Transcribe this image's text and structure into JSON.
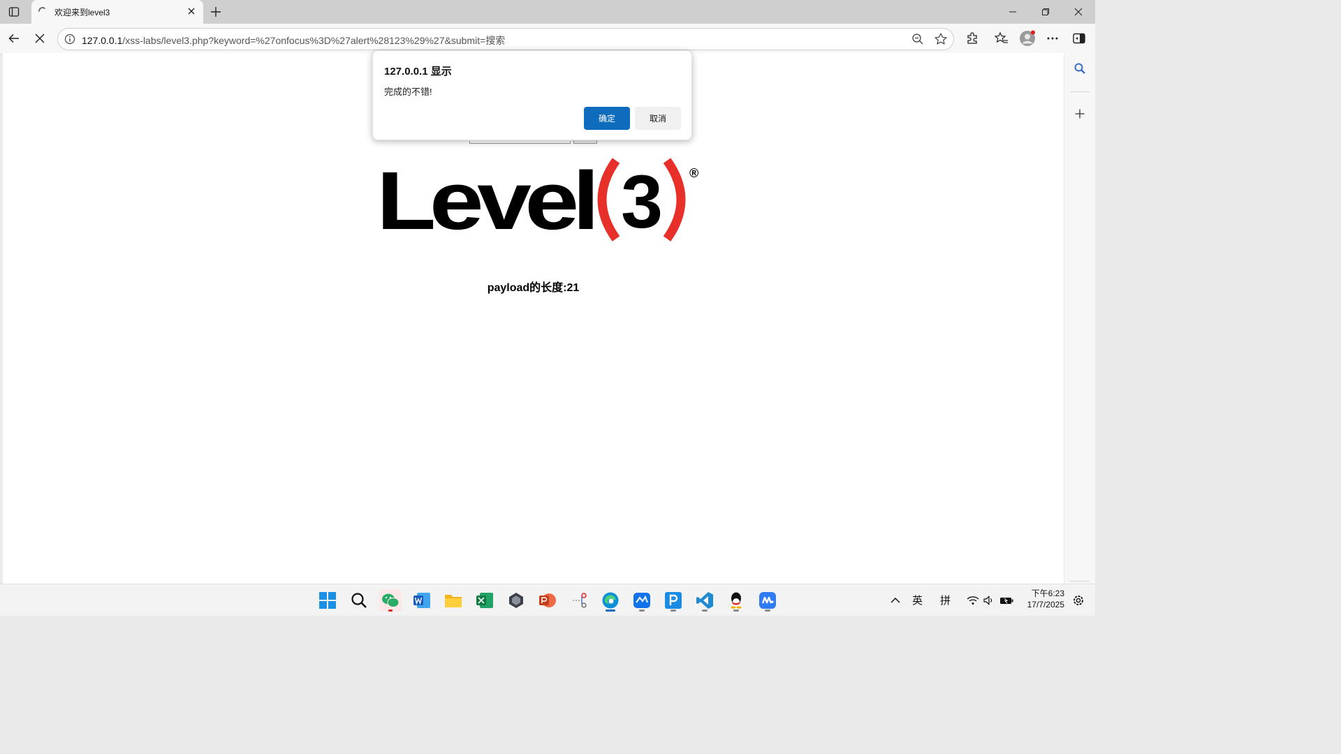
{
  "tab": {
    "title": "欢迎来到level3"
  },
  "address": {
    "host": "127.0.0.1",
    "path": "/xss-labs/level3.php?keyword=%27onfocus%3D%27alert%28123%29%27&submit=搜索"
  },
  "page": {
    "logo_text": "Level",
    "logo_number": "3",
    "logo_mark": "®",
    "payload_length": "payload的长度:21"
  },
  "dialog": {
    "title": "127.0.0.1 显示",
    "message": "完成的不错!",
    "ok_label": "确定",
    "cancel_label": "取消"
  },
  "tray": {
    "lang1": "英",
    "lang2": "拼",
    "time": "下午6:23",
    "date": "17/7/2025"
  },
  "colors": {
    "accent": "#0f6cbd",
    "logo_red": "#e8302a"
  },
  "taskbar_icons": [
    "windows-start-icon",
    "search-icon",
    "wechat-icon",
    "word-icon",
    "file-explorer-icon",
    "excel-icon",
    "app-cube-icon",
    "powerpoint-icon",
    "network-app-icon",
    "edge-icon",
    "board-app-icon",
    "pycharm-icon",
    "vscode-icon",
    "qq-icon",
    "wps-icon"
  ]
}
